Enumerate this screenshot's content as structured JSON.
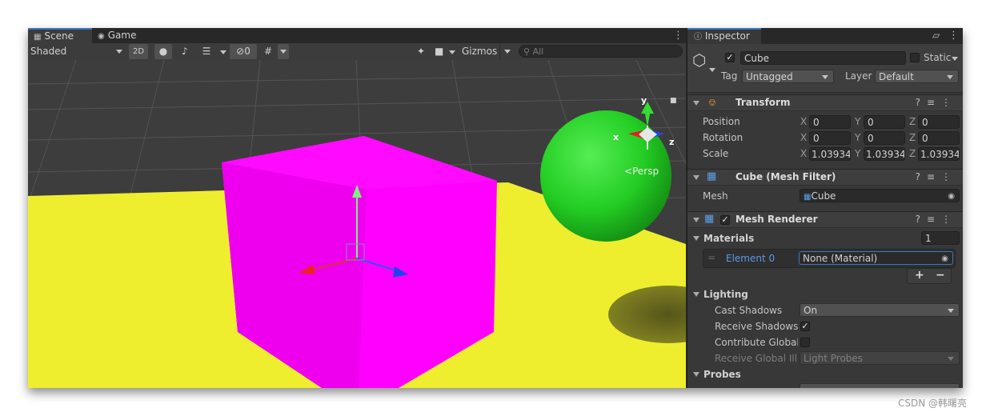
{
  "scene": {
    "tabs": [
      {
        "icon": "scene-icon",
        "label": "Scene"
      },
      {
        "icon": "game-icon",
        "label": "Game"
      }
    ],
    "draw_mode": "Shaded",
    "toggle_2d": "2D",
    "hidden_count": "0",
    "gizmos_label": "Gizmos",
    "search_placeholder": "All",
    "persp_label": "Persp",
    "axis_labels": {
      "x": "x",
      "y": "y",
      "z": "z"
    }
  },
  "inspector": {
    "tab_label": "Inspector",
    "object_name": "Cube",
    "static_label": "Static",
    "tag_label": "Tag",
    "tag_value": "Untagged",
    "layer_label": "Layer",
    "layer_value": "Default",
    "transform": {
      "title": "Transform",
      "rows": [
        {
          "label": "Position",
          "x": "0",
          "y": "0",
          "z": "0"
        },
        {
          "label": "Rotation",
          "x": "0",
          "y": "0",
          "z": "0"
        },
        {
          "label": "Scale",
          "x": "1.03934",
          "y": "1.03934",
          "z": "1.03934"
        }
      ],
      "axis": {
        "x": "X",
        "y": "Y",
        "z": "Z"
      }
    },
    "mesh_filter": {
      "title": "Cube (Mesh Filter)",
      "mesh_label": "Mesh",
      "mesh_value": "Cube"
    },
    "mesh_renderer": {
      "title": "Mesh Renderer",
      "materials_label": "Materials",
      "materials_count": "1",
      "element_label": "Element 0",
      "element_value": "None (Material)",
      "add": "+",
      "remove": "−",
      "lighting_label": "Lighting",
      "cast_shadows_label": "Cast Shadows",
      "cast_shadows_value": "On",
      "receive_shadows_label": "Receive Shadows",
      "contribute_gi_label": "Contribute Global I",
      "receive_gi_label": "Receive Global Illu",
      "receive_gi_value": "Light Probes",
      "probes_label": "Probes"
    }
  },
  "watermark": "CSDN @韩曙亮",
  "colors": {
    "cube": "#ff00ff",
    "ground": "#eeee2e",
    "sphere": "#22cc22",
    "accent": "#3a79bb"
  }
}
